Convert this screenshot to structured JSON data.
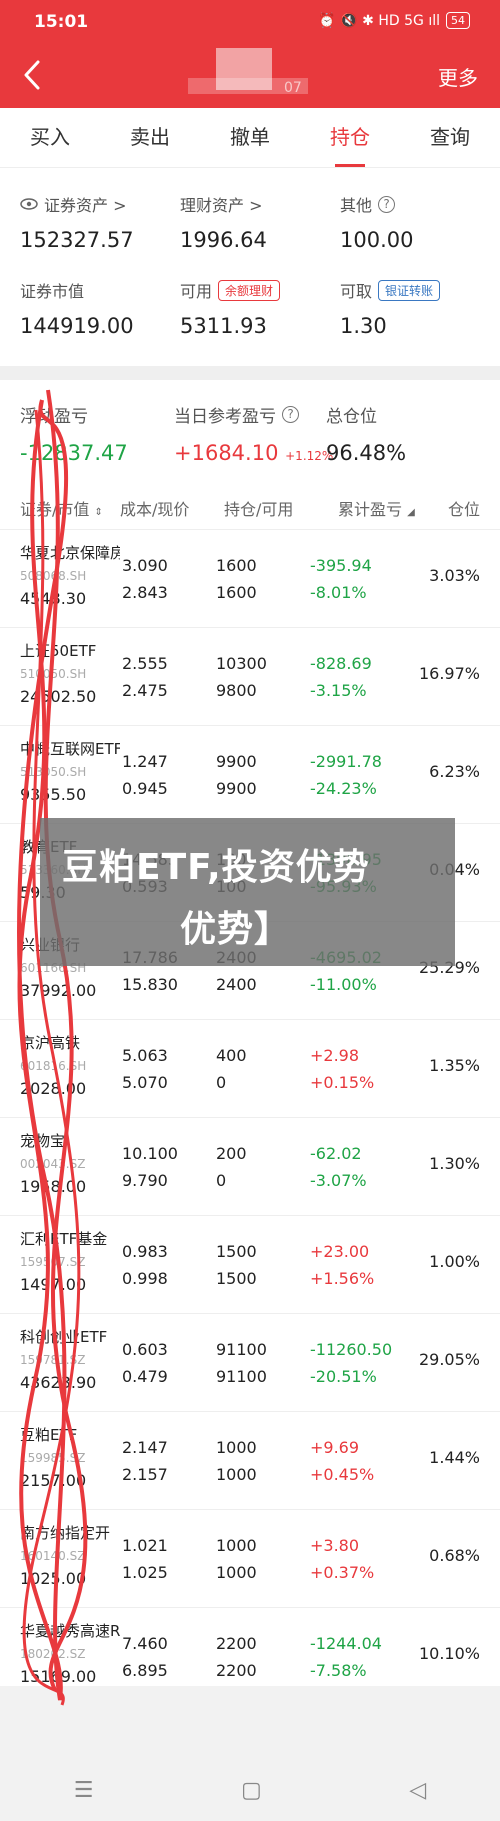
{
  "status_bar": {
    "time": "15:01",
    "icons": "⏰ 🔇 ✱ HD 5G ıll",
    "battery": "54"
  },
  "header": {
    "account_fragment": "07",
    "more_label": "更多"
  },
  "tabs": [
    "买入",
    "卖出",
    "撤单",
    "持仓",
    "查询"
  ],
  "assets": {
    "securities_label": "证券资产 >",
    "securities_value": "152327.57",
    "wealth_label": "理财资产 >",
    "wealth_value": "1996.64",
    "other_label": "其他",
    "other_value": "100.00",
    "market_value_label": "证券市值",
    "market_value": "144919.00",
    "available_label": "可用",
    "available_tag": "余额理财",
    "available_value": "5311.93",
    "withdrawable_label": "可取",
    "withdrawable_tag": "银证转账",
    "withdrawable_value": "1.30"
  },
  "summary": {
    "floating_label": "浮动盈亏",
    "floating_value": "-12837.47",
    "daily_label": "当日参考盈亏",
    "daily_value": "+1684.10",
    "daily_pct": "+1.12%",
    "position_label": "总仓位",
    "position_value": "96.48%"
  },
  "table_header": {
    "name": "证券/市值",
    "cost": "成本/现价",
    "qty": "持仓/可用",
    "pnl": "累计盈亏",
    "ratio": "仓位"
  },
  "rows": [
    {
      "name": "华夏北京保障房",
      "code": "508068.SH",
      "mv": "4548.30",
      "cost": "3.090",
      "price": "2.843",
      "hold": "1600",
      "avail": "1600",
      "pnl": "-395.94",
      "pnl_pct": "-8.01%",
      "ratio": "3.03%",
      "up": false
    },
    {
      "name": "上证50ETF",
      "code": "510050.SH",
      "mv": "24502.50",
      "cost": "2.555",
      "price": "2.475",
      "hold": "10300",
      "avail": "9800",
      "pnl": "-828.69",
      "pnl_pct": "-3.15%",
      "ratio": "16.97%",
      "up": false
    },
    {
      "name": "中概互联网ETF",
      "code": "513050.SH",
      "mv": "9355.50",
      "cost": "1.247",
      "price": "0.945",
      "hold": "9900",
      "avail": "9900",
      "pnl": "-2991.78",
      "pnl_pct": "-24.23%",
      "ratio": "6.23%",
      "up": false
    },
    {
      "name": "教育ETF",
      "code": "513360.SH",
      "mv": "59.30",
      "cost": "14.583",
      "price": "0.593",
      "hold": "100",
      "avail": "100",
      "pnl": "-1398.95",
      "pnl_pct": "-95.93%",
      "ratio": "0.04%",
      "up": false
    },
    {
      "name": "兴业银行",
      "code": "601166.SH",
      "mv": "37992.00",
      "cost": "17.786",
      "price": "15.830",
      "hold": "2400",
      "avail": "2400",
      "pnl": "-4695.02",
      "pnl_pct": "-11.00%",
      "ratio": "25.29%",
      "up": false
    },
    {
      "name": "京沪高铁",
      "code": "601816.SH",
      "mv": "2028.00",
      "cost": "5.063",
      "price": "5.070",
      "hold": "400",
      "avail": "0",
      "pnl": "+2.98",
      "pnl_pct": "+0.15%",
      "ratio": "1.35%",
      "up": true
    },
    {
      "name": "宠物宝",
      "code": "002043.SZ",
      "mv": "1958.00",
      "cost": "10.100",
      "price": "9.790",
      "hold": "200",
      "avail": "0",
      "pnl": "-62.02",
      "pnl_pct": "-3.07%",
      "ratio": "1.30%",
      "up": false
    },
    {
      "name": "汇利ETF基金",
      "code": "159507.SZ",
      "mv": "1497.00",
      "cost": "0.983",
      "price": "0.998",
      "hold": "1500",
      "avail": "1500",
      "pnl": "+23.00",
      "pnl_pct": "+1.56%",
      "ratio": "1.00%",
      "up": true
    },
    {
      "name": "科创创业ETF",
      "code": "159781.SZ",
      "mv": "43623.90",
      "cost": "0.603",
      "price": "0.479",
      "hold": "91100",
      "avail": "91100",
      "pnl": "-11260.50",
      "pnl_pct": "-20.51%",
      "ratio": "29.05%",
      "up": false
    },
    {
      "name": "豆粕ETF",
      "code": "159985.SZ",
      "mv": "2157.00",
      "cost": "2.147",
      "price": "2.157",
      "hold": "1000",
      "avail": "1000",
      "pnl": "+9.69",
      "pnl_pct": "+0.45%",
      "ratio": "1.44%",
      "up": true
    },
    {
      "name": "南方纳指定开",
      "code": "160140.SZ",
      "mv": "1025.00",
      "cost": "1.021",
      "price": "1.025",
      "hold": "1000",
      "avail": "1000",
      "pnl": "+3.80",
      "pnl_pct": "+0.37%",
      "ratio": "0.68%",
      "up": true
    },
    {
      "name": "华夏越秀高速REIT",
      "code": "180202.SZ",
      "mv": "15169.00",
      "cost": "7.460",
      "price": "6.895",
      "hold": "2200",
      "avail": "2200",
      "pnl": "-1244.04",
      "pnl_pct": "-7.58%",
      "ratio": "10.10%",
      "up": false
    }
  ],
  "overlay": {
    "line1": "豆粕ETF,投资优势",
    "line2": "优势】"
  },
  "nav": {
    "menu": "☰",
    "home": "▢",
    "back": "◁"
  },
  "colors": {
    "brand_red": "#e8393d",
    "gain": "#e8393d",
    "loss": "#1fa446",
    "link_blue": "#3a78c2"
  }
}
